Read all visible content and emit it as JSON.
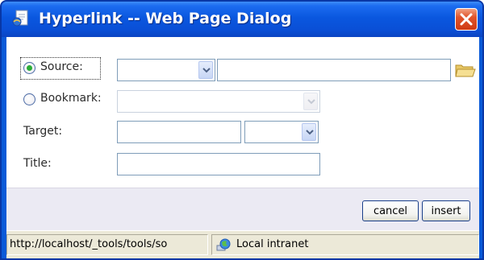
{
  "window": {
    "title": "Hyperlink -- Web Page Dialog"
  },
  "form": {
    "source": {
      "label": "Source:",
      "checked": true,
      "protocol_value": "",
      "url_value": ""
    },
    "bookmark": {
      "label": "Bookmark:",
      "checked": false,
      "value": ""
    },
    "target": {
      "label": "Target:",
      "value": "",
      "select_value": ""
    },
    "title": {
      "label": "Title:",
      "value": ""
    }
  },
  "buttons": {
    "cancel": "cancel",
    "insert": "insert"
  },
  "statusbar": {
    "url": "http://localhost/_tools/tools/so",
    "zone": "Local intranet"
  },
  "icons": {
    "title": "ie-page-icon",
    "close": "close-icon",
    "browse": "folder-icon",
    "dropdown": "chevron-down-icon",
    "zone": "intranet-globe-icon"
  },
  "colors": {
    "titlebar": "#0a57df",
    "close_button": "#e0542c",
    "dialog_background": "#ebeaf3",
    "statusbar": "#ece9d8",
    "radio_checked": "#2bad37"
  }
}
